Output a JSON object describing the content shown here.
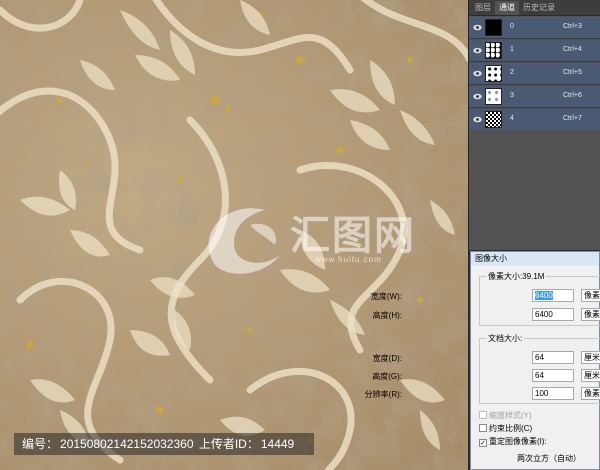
{
  "panel": {
    "tabs": [
      "图层",
      "通道",
      "历史记录"
    ],
    "active_tab": 1,
    "channels": [
      {
        "name": "0",
        "shortcut": "Ctrl+3"
      },
      {
        "name": "1",
        "shortcut": "Ctrl+4"
      },
      {
        "name": "2",
        "shortcut": "Ctrl+5"
      },
      {
        "name": "3",
        "shortcut": "Ctrl+6"
      },
      {
        "name": "4",
        "shortcut": "Ctrl+7"
      }
    ]
  },
  "dialog": {
    "title": "图像大小",
    "pixel_dimensions_label": "像素大小:39.1M",
    "width_label": "宽度(W):",
    "width_value": "6400",
    "width_unit": "像素",
    "height_label": "高度(H):",
    "height_value": "6400",
    "height_unit": "像素",
    "doc_size_label": "文档大小:",
    "doc_width_label": "宽度(D):",
    "doc_width_value": "64",
    "doc_width_unit": "厘米",
    "doc_height_label": "高度(G):",
    "doc_height_value": "64",
    "doc_height_unit": "厘米",
    "resolution_label": "分辨率(R):",
    "resolution_value": "100",
    "resolution_unit": "像素/英寸",
    "scale_styles_label": "缩放样式(Y)",
    "constrain_label": "约束比例(C)",
    "resample_label": "重定图像像素(I):",
    "resample_method": "两次立方（自动）"
  },
  "watermark": {
    "brand": "汇图网",
    "url": "www.huitu.com"
  },
  "caption": {
    "id_label": "编号：",
    "id_value": "20150802142152032360",
    "uploader_label": "上传者ID：",
    "uploader_value": "14449"
  },
  "colors": {
    "panel_bg": "#535353",
    "selection": "#4a5a73",
    "texture_base": "#b59c77",
    "ornament": "#efe3c8",
    "gold": "#d4a832"
  }
}
